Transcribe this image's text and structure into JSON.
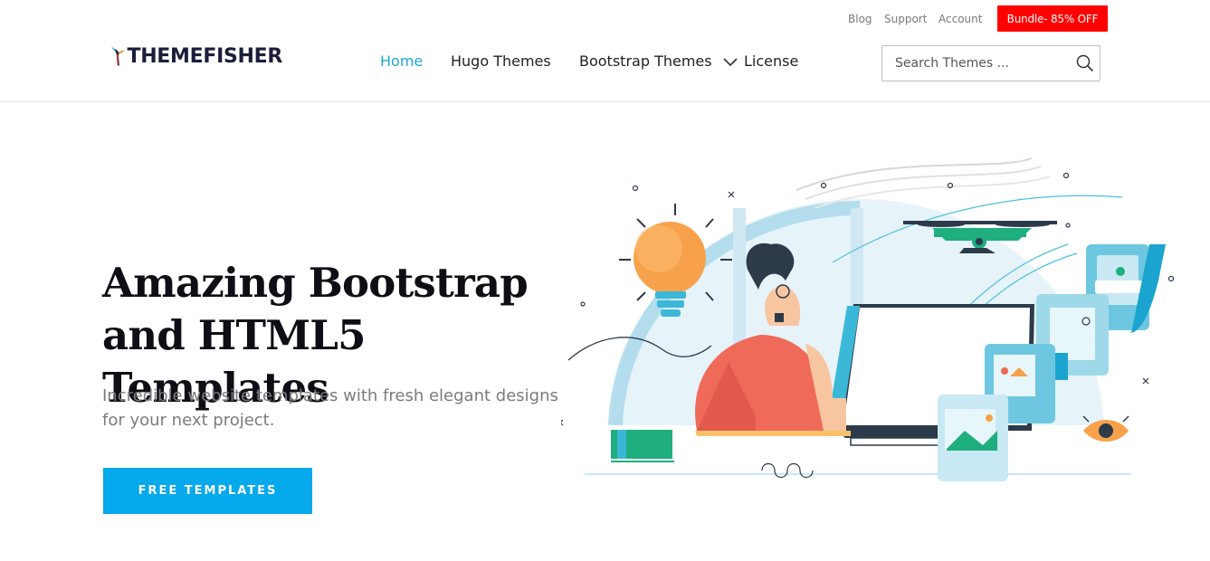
{
  "topbar": {
    "links": [
      "Blog",
      "Support",
      "Account"
    ],
    "bundle_label": "Bundle- 85% OFF"
  },
  "brand": {
    "name": "THEMEFISHER"
  },
  "nav": {
    "items": [
      {
        "label": "Home",
        "active": true
      },
      {
        "label": "Hugo Themes",
        "active": false
      },
      {
        "label": "Bootstrap Themes",
        "active": false,
        "dropdown": true
      },
      {
        "label": "License",
        "active": false
      }
    ]
  },
  "search": {
    "placeholder": "Search Themes ..."
  },
  "hero": {
    "title_line1": "Amazing Bootstrap",
    "title_line2": "and HTML5 Templates",
    "subtitle": "Incredible website templates with fresh elegant designs for your next project.",
    "cta_label": "FREE TEMPLATES"
  },
  "colors": {
    "accent": "#05a9ec",
    "nav_active": "#1da8d6",
    "bundle": "#ff0000",
    "heading": "#0e0e14"
  }
}
